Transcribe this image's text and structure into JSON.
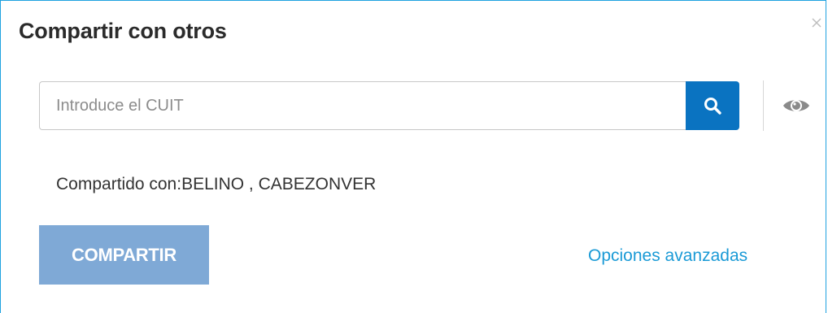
{
  "dialog": {
    "title": "Compartir con otros",
    "close_icon": "close-icon",
    "search": {
      "placeholder": "Introduce el CUIT",
      "value": "",
      "button_icon": "search-icon"
    },
    "visibility_icon": "eye-icon",
    "shared_with_text": "Compartido con:BELINO , CABEZONVER",
    "share_button_label": "COMPARTIR",
    "advanced_options_label": "Opciones avanzadas"
  },
  "colors": {
    "accent": "#0a73c1",
    "border": "#1fa2e0",
    "share_button": "#7fa9d6",
    "link": "#1a9ad6"
  }
}
